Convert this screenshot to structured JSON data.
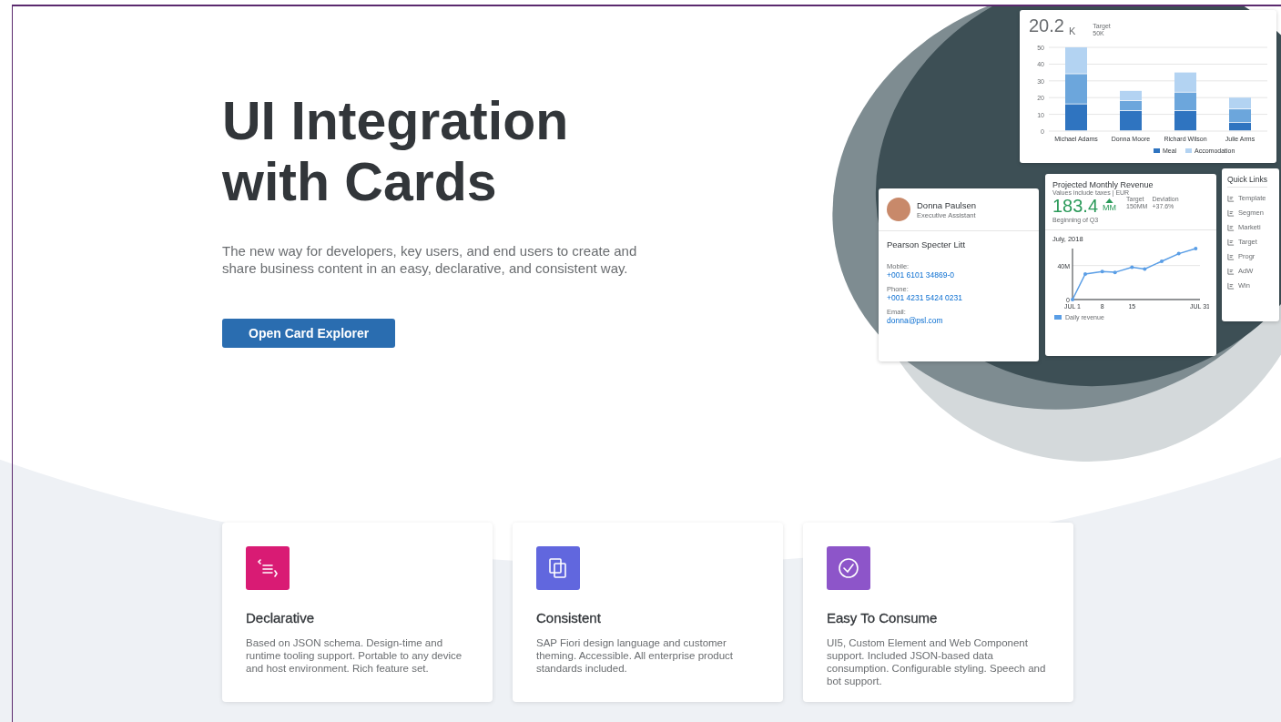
{
  "hero": {
    "title": "UI Integration with Cards",
    "subtitle": "The new way for developers, key users, and end users to create and share business content in an easy, declarative, and consistent way.",
    "button": "Open Card Explorer"
  },
  "illustration": {
    "analytics_card": {
      "value": "20.2",
      "unit": "K",
      "target_label": "Target",
      "target_value": "50K",
      "chart_data": {
        "type": "bar",
        "stacked": true,
        "grid": true,
        "legend": "bottom",
        "categories": [
          "Michael Adams",
          "Donna Moore",
          "Richard Wilson",
          "Julie Arms"
        ],
        "yticks": [
          0,
          10,
          20,
          30,
          40,
          50
        ],
        "ylim": [
          0,
          50
        ],
        "series": [
          {
            "name": "Meal",
            "color": "#2f74c0",
            "values": [
              16,
              12,
              12,
              5
            ]
          },
          {
            "color": "#6ca6dc",
            "values": [
              18,
              6,
              11,
              8
            ]
          },
          {
            "name": "Accomodation",
            "color": "#b3d3f2",
            "values": [
              16,
              6,
              12,
              7
            ]
          }
        ]
      }
    },
    "contact_card": {
      "name": "Donna Paulsen",
      "role": "Executive Assistant",
      "company": "Pearson Specter Litt",
      "fields": [
        {
          "label": "Mobile:",
          "value": "+001 6101 34869-0"
        },
        {
          "label": "Phone:",
          "value": "+001 4231 5424 0231"
        },
        {
          "label": "Email:",
          "value": "donna@psl.com"
        }
      ]
    },
    "revenue_card": {
      "title": "Projected Monthly Revenue",
      "subtitle": "Values include taxes | EUR",
      "value": "183.4",
      "unit": "MM",
      "trend_up": true,
      "target_label": "Target",
      "target_value": "150MM",
      "deviation_label": "Deviation",
      "deviation_value": "+37.6%",
      "details": "Beginning of Q3",
      "chart_title": "July, 2018",
      "chart_data": {
        "type": "line",
        "x": [
          1,
          4,
          8,
          11,
          15,
          18,
          22,
          26,
          30
        ],
        "yticks": [
          {
            "value": 0,
            "label": "0"
          },
          {
            "value": 40,
            "label": "40M"
          }
        ],
        "xticks": [
          {
            "value": 1,
            "label": "JUL 1"
          },
          {
            "value": 8,
            "label": "8"
          },
          {
            "value": 15,
            "label": "15"
          },
          {
            "value": 31,
            "label": "JUL 31"
          }
        ],
        "xlim": [
          1,
          31
        ],
        "ylim": [
          0,
          60
        ],
        "series": [
          {
            "name": "Daily revenue",
            "color": "#5a9ee6",
            "values": [
              0,
              30,
              33,
              32,
              38,
              36,
              45,
              54,
              60
            ]
          }
        ]
      }
    },
    "links_card": {
      "title": "Quick Links",
      "items": [
        {
          "label": "Template"
        },
        {
          "label": "Segmen"
        },
        {
          "label": "Marketi"
        },
        {
          "label": "Target"
        },
        {
          "label": "Progr"
        },
        {
          "label": "AdW"
        },
        {
          "label": "Win"
        }
      ]
    }
  },
  "features": [
    {
      "color": "#d91b74",
      "title": "Declarative",
      "text": "Based on JSON schema. Design-time and runtime tooling support. Portable to any device and host environment. Rich feature set."
    },
    {
      "color": "#6167de",
      "title": "Consistent",
      "text": "SAP Fiori design language and customer theming. Accessible. All enterprise product standards included."
    },
    {
      "color": "#8d55c9",
      "title": "Easy To Consume",
      "text": "UI5, Custom Element and Web Component support. Included JSON-based data consumption. Configurable styling. Speech and bot support."
    }
  ]
}
